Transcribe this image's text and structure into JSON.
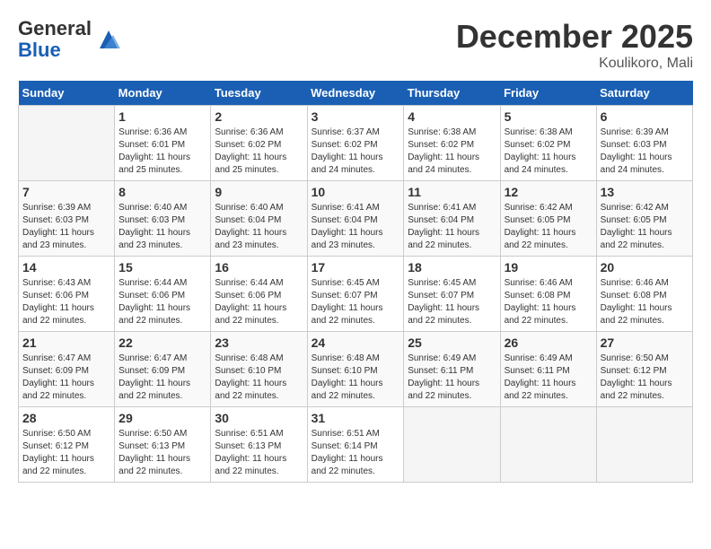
{
  "logo": {
    "general": "General",
    "blue": "Blue"
  },
  "header": {
    "title": "December 2025",
    "location": "Koulikoro, Mali"
  },
  "weekdays": [
    "Sunday",
    "Monday",
    "Tuesday",
    "Wednesday",
    "Thursday",
    "Friday",
    "Saturday"
  ],
  "weeks": [
    [
      {
        "day": "",
        "sunrise": "",
        "sunset": "",
        "daylight": ""
      },
      {
        "day": "1",
        "sunrise": "Sunrise: 6:36 AM",
        "sunset": "Sunset: 6:01 PM",
        "daylight": "Daylight: 11 hours and 25 minutes."
      },
      {
        "day": "2",
        "sunrise": "Sunrise: 6:36 AM",
        "sunset": "Sunset: 6:02 PM",
        "daylight": "Daylight: 11 hours and 25 minutes."
      },
      {
        "day": "3",
        "sunrise": "Sunrise: 6:37 AM",
        "sunset": "Sunset: 6:02 PM",
        "daylight": "Daylight: 11 hours and 24 minutes."
      },
      {
        "day": "4",
        "sunrise": "Sunrise: 6:38 AM",
        "sunset": "Sunset: 6:02 PM",
        "daylight": "Daylight: 11 hours and 24 minutes."
      },
      {
        "day": "5",
        "sunrise": "Sunrise: 6:38 AM",
        "sunset": "Sunset: 6:02 PM",
        "daylight": "Daylight: 11 hours and 24 minutes."
      },
      {
        "day": "6",
        "sunrise": "Sunrise: 6:39 AM",
        "sunset": "Sunset: 6:03 PM",
        "daylight": "Daylight: 11 hours and 24 minutes."
      }
    ],
    [
      {
        "day": "7",
        "sunrise": "Sunrise: 6:39 AM",
        "sunset": "Sunset: 6:03 PM",
        "daylight": "Daylight: 11 hours and 23 minutes."
      },
      {
        "day": "8",
        "sunrise": "Sunrise: 6:40 AM",
        "sunset": "Sunset: 6:03 PM",
        "daylight": "Daylight: 11 hours and 23 minutes."
      },
      {
        "day": "9",
        "sunrise": "Sunrise: 6:40 AM",
        "sunset": "Sunset: 6:04 PM",
        "daylight": "Daylight: 11 hours and 23 minutes."
      },
      {
        "day": "10",
        "sunrise": "Sunrise: 6:41 AM",
        "sunset": "Sunset: 6:04 PM",
        "daylight": "Daylight: 11 hours and 23 minutes."
      },
      {
        "day": "11",
        "sunrise": "Sunrise: 6:41 AM",
        "sunset": "Sunset: 6:04 PM",
        "daylight": "Daylight: 11 hours and 22 minutes."
      },
      {
        "day": "12",
        "sunrise": "Sunrise: 6:42 AM",
        "sunset": "Sunset: 6:05 PM",
        "daylight": "Daylight: 11 hours and 22 minutes."
      },
      {
        "day": "13",
        "sunrise": "Sunrise: 6:42 AM",
        "sunset": "Sunset: 6:05 PM",
        "daylight": "Daylight: 11 hours and 22 minutes."
      }
    ],
    [
      {
        "day": "14",
        "sunrise": "Sunrise: 6:43 AM",
        "sunset": "Sunset: 6:06 PM",
        "daylight": "Daylight: 11 hours and 22 minutes."
      },
      {
        "day": "15",
        "sunrise": "Sunrise: 6:44 AM",
        "sunset": "Sunset: 6:06 PM",
        "daylight": "Daylight: 11 hours and 22 minutes."
      },
      {
        "day": "16",
        "sunrise": "Sunrise: 6:44 AM",
        "sunset": "Sunset: 6:06 PM",
        "daylight": "Daylight: 11 hours and 22 minutes."
      },
      {
        "day": "17",
        "sunrise": "Sunrise: 6:45 AM",
        "sunset": "Sunset: 6:07 PM",
        "daylight": "Daylight: 11 hours and 22 minutes."
      },
      {
        "day": "18",
        "sunrise": "Sunrise: 6:45 AM",
        "sunset": "Sunset: 6:07 PM",
        "daylight": "Daylight: 11 hours and 22 minutes."
      },
      {
        "day": "19",
        "sunrise": "Sunrise: 6:46 AM",
        "sunset": "Sunset: 6:08 PM",
        "daylight": "Daylight: 11 hours and 22 minutes."
      },
      {
        "day": "20",
        "sunrise": "Sunrise: 6:46 AM",
        "sunset": "Sunset: 6:08 PM",
        "daylight": "Daylight: 11 hours and 22 minutes."
      }
    ],
    [
      {
        "day": "21",
        "sunrise": "Sunrise: 6:47 AM",
        "sunset": "Sunset: 6:09 PM",
        "daylight": "Daylight: 11 hours and 22 minutes."
      },
      {
        "day": "22",
        "sunrise": "Sunrise: 6:47 AM",
        "sunset": "Sunset: 6:09 PM",
        "daylight": "Daylight: 11 hours and 22 minutes."
      },
      {
        "day": "23",
        "sunrise": "Sunrise: 6:48 AM",
        "sunset": "Sunset: 6:10 PM",
        "daylight": "Daylight: 11 hours and 22 minutes."
      },
      {
        "day": "24",
        "sunrise": "Sunrise: 6:48 AM",
        "sunset": "Sunset: 6:10 PM",
        "daylight": "Daylight: 11 hours and 22 minutes."
      },
      {
        "day": "25",
        "sunrise": "Sunrise: 6:49 AM",
        "sunset": "Sunset: 6:11 PM",
        "daylight": "Daylight: 11 hours and 22 minutes."
      },
      {
        "day": "26",
        "sunrise": "Sunrise: 6:49 AM",
        "sunset": "Sunset: 6:11 PM",
        "daylight": "Daylight: 11 hours and 22 minutes."
      },
      {
        "day": "27",
        "sunrise": "Sunrise: 6:50 AM",
        "sunset": "Sunset: 6:12 PM",
        "daylight": "Daylight: 11 hours and 22 minutes."
      }
    ],
    [
      {
        "day": "28",
        "sunrise": "Sunrise: 6:50 AM",
        "sunset": "Sunset: 6:12 PM",
        "daylight": "Daylight: 11 hours and 22 minutes."
      },
      {
        "day": "29",
        "sunrise": "Sunrise: 6:50 AM",
        "sunset": "Sunset: 6:13 PM",
        "daylight": "Daylight: 11 hours and 22 minutes."
      },
      {
        "day": "30",
        "sunrise": "Sunrise: 6:51 AM",
        "sunset": "Sunset: 6:13 PM",
        "daylight": "Daylight: 11 hours and 22 minutes."
      },
      {
        "day": "31",
        "sunrise": "Sunrise: 6:51 AM",
        "sunset": "Sunset: 6:14 PM",
        "daylight": "Daylight: 11 hours and 22 minutes."
      },
      {
        "day": "",
        "sunrise": "",
        "sunset": "",
        "daylight": ""
      },
      {
        "day": "",
        "sunrise": "",
        "sunset": "",
        "daylight": ""
      },
      {
        "day": "",
        "sunrise": "",
        "sunset": "",
        "daylight": ""
      }
    ]
  ]
}
